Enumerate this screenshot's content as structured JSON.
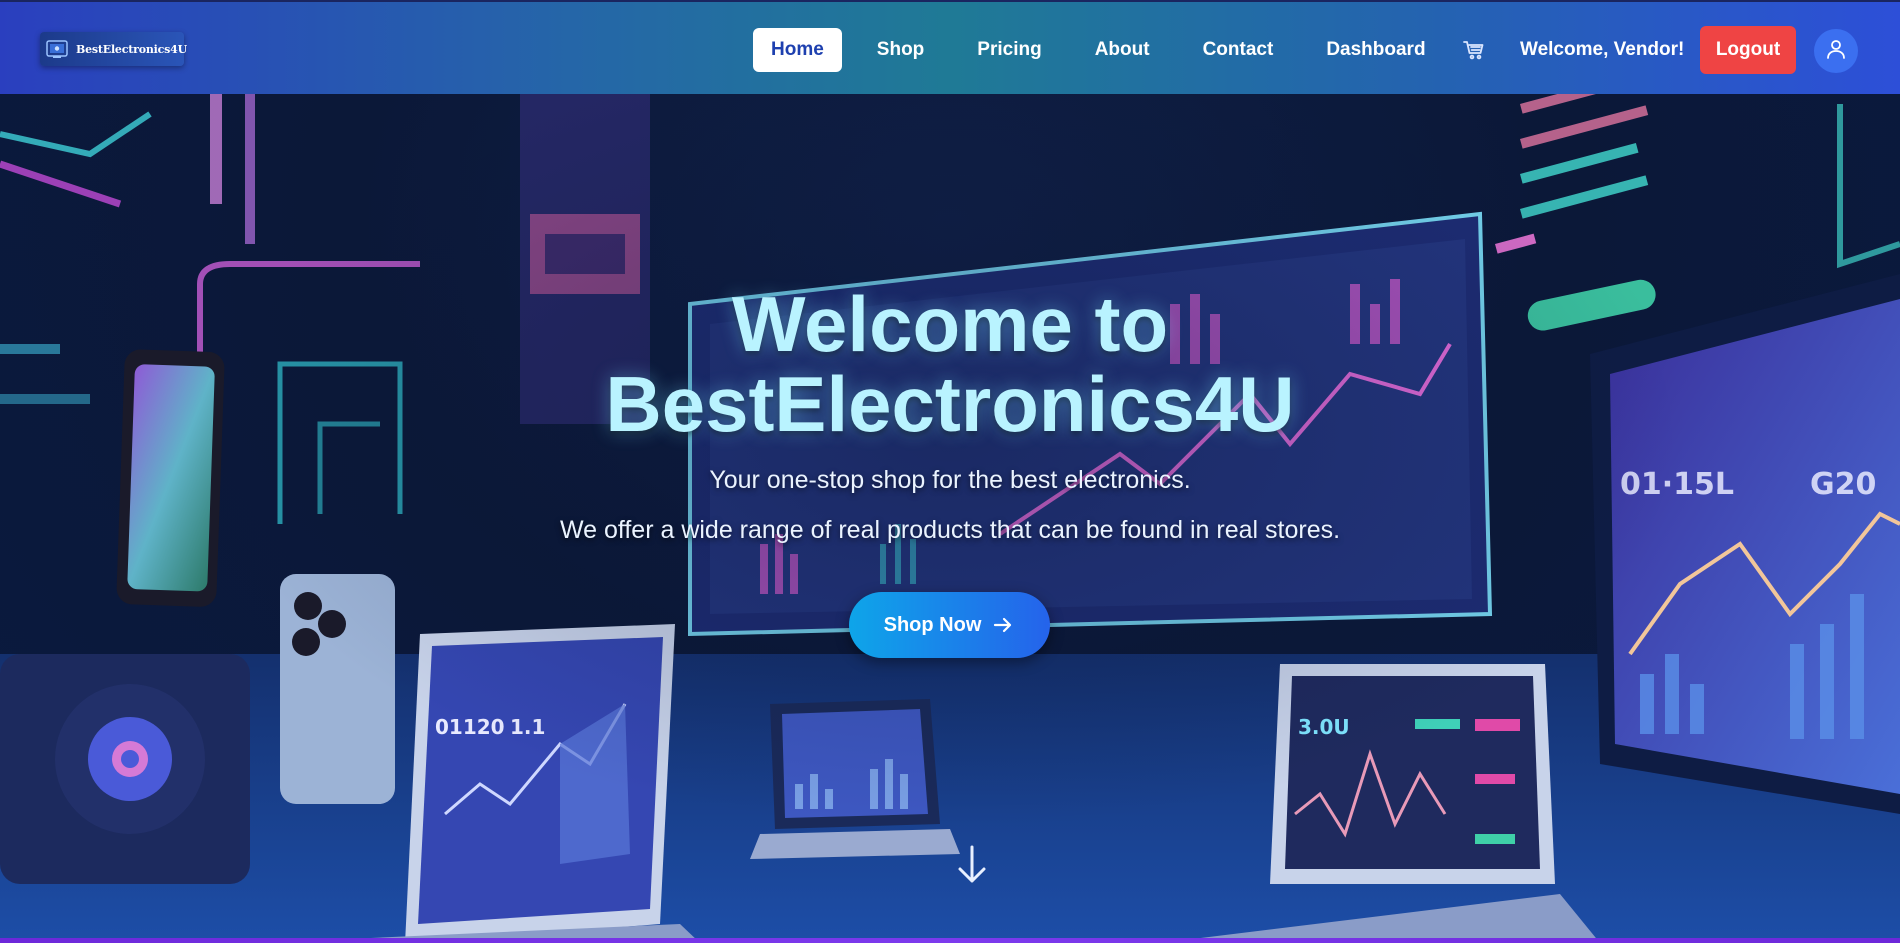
{
  "brand": {
    "name": "BestElectronics4U"
  },
  "nav": {
    "items": [
      {
        "label": "Home",
        "active": true
      },
      {
        "label": "Shop",
        "active": false
      },
      {
        "label": "Pricing",
        "active": false
      },
      {
        "label": "About",
        "active": false
      },
      {
        "label": "Contact",
        "active": false
      },
      {
        "label": "Dashboard",
        "active": false
      }
    ],
    "cart_icon": "cart-icon",
    "welcome_text": "Welcome, Vendor!",
    "logout_label": "Logout",
    "avatar_icon": "user-icon"
  },
  "hero": {
    "title_line1": "Welcome to",
    "title_line2": "BestElectronics4U",
    "subtitle_line1": "Your one-stop shop for the best electronics.",
    "subtitle_line2": "We offer a wide range of real products that can be found in real stores.",
    "cta_label": "Shop Now",
    "cta_icon": "arrow-right-icon",
    "scroll_icon": "arrow-down-icon"
  },
  "colors": {
    "accent": "#1e40af",
    "logout": "#ef4444",
    "cta_start": "#0ea5e9",
    "cta_end": "#2563eb",
    "title": "#b9f3ff"
  }
}
